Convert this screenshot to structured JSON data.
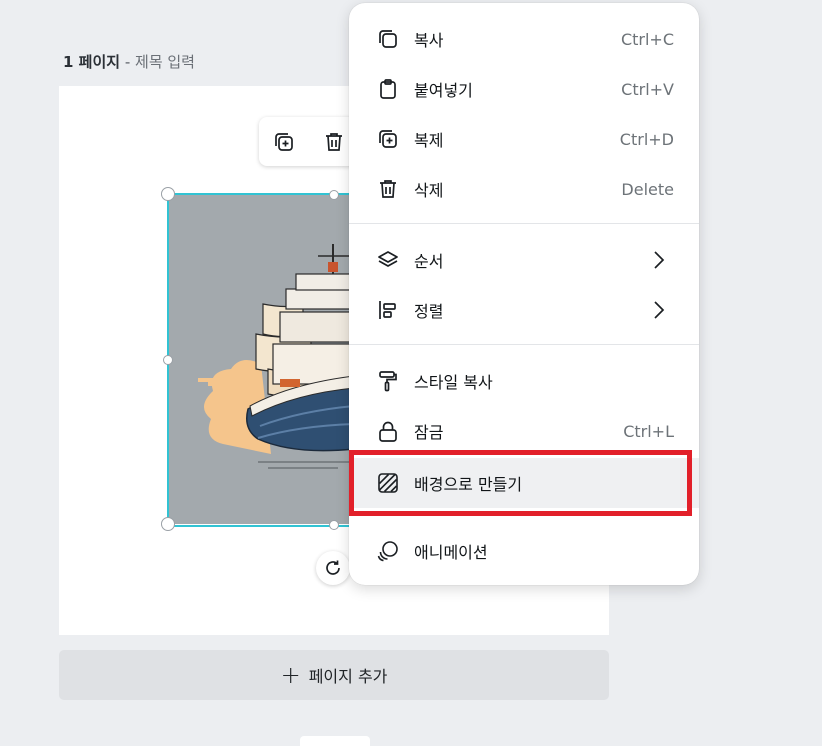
{
  "page": {
    "number_label": "1 페이지",
    "separator": " - ",
    "title_placeholder": "제목 입력",
    "add_page_label": "페이지 추가"
  },
  "context_menu": {
    "items": [
      {
        "label": "복사",
        "shortcut": "Ctrl+C",
        "icon": "copy-icon"
      },
      {
        "label": "붙여넣기",
        "shortcut": "Ctrl+V",
        "icon": "clipboard-icon"
      },
      {
        "label": "복제",
        "shortcut": "Ctrl+D",
        "icon": "duplicate-icon"
      },
      {
        "label": "삭제",
        "shortcut": "Delete",
        "icon": "trash-icon"
      },
      {
        "label": "순서",
        "shortcut": "",
        "icon": "layers-icon"
      },
      {
        "label": "정렬",
        "shortcut": "",
        "icon": "align-icon"
      },
      {
        "label": "스타일 복사",
        "shortcut": "",
        "icon": "paint-roller-icon"
      },
      {
        "label": "잠금",
        "shortcut": "Ctrl+L",
        "icon": "lock-icon"
      },
      {
        "label": "배경으로 만들기",
        "shortcut": "",
        "icon": "background-hatch-icon"
      },
      {
        "label": "애니메이션",
        "shortcut": "",
        "icon": "animation-icon"
      }
    ],
    "highlighted_item": "배경으로 만들기"
  },
  "colors": {
    "selection": "#31c3d3",
    "highlight_box": "#e2202a",
    "canvas_bg": "#eceef1"
  }
}
